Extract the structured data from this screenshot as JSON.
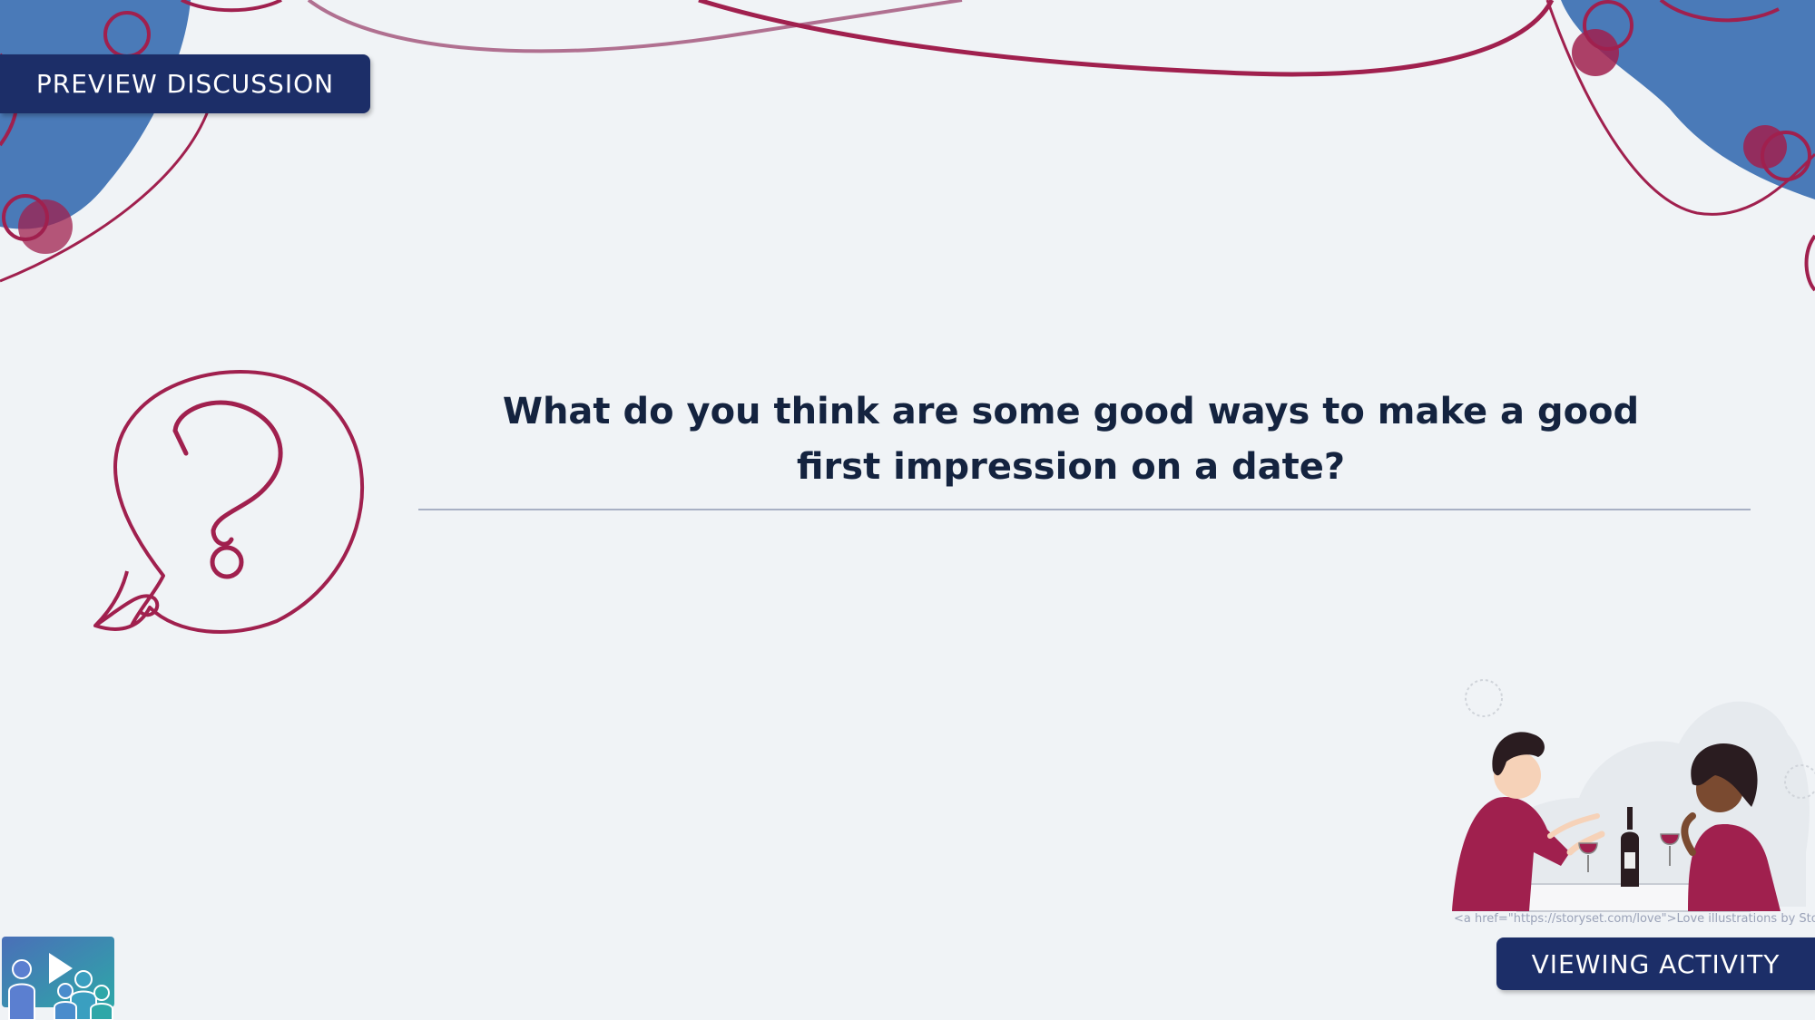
{
  "slide": {
    "top_badge": "PREVIEW DISCUSSION",
    "question": "What do you think are some good ways to make a good first impression on a date?",
    "bottom_badge": "VIEWING ACTIVITY",
    "credit": "<a href=\"https://storyset.com/love\">Love illustrations by Storyset</a>"
  },
  "colors": {
    "navy": "#1c2e68",
    "magenta": "#a0204e",
    "blue_blob": "#4a7ab8",
    "background": "#f0f3f6"
  },
  "icons": {
    "question_bubble": "question-bubble-icon",
    "video_group_logo": "video-group-icon",
    "illustration": "dinner-date-illustration"
  }
}
